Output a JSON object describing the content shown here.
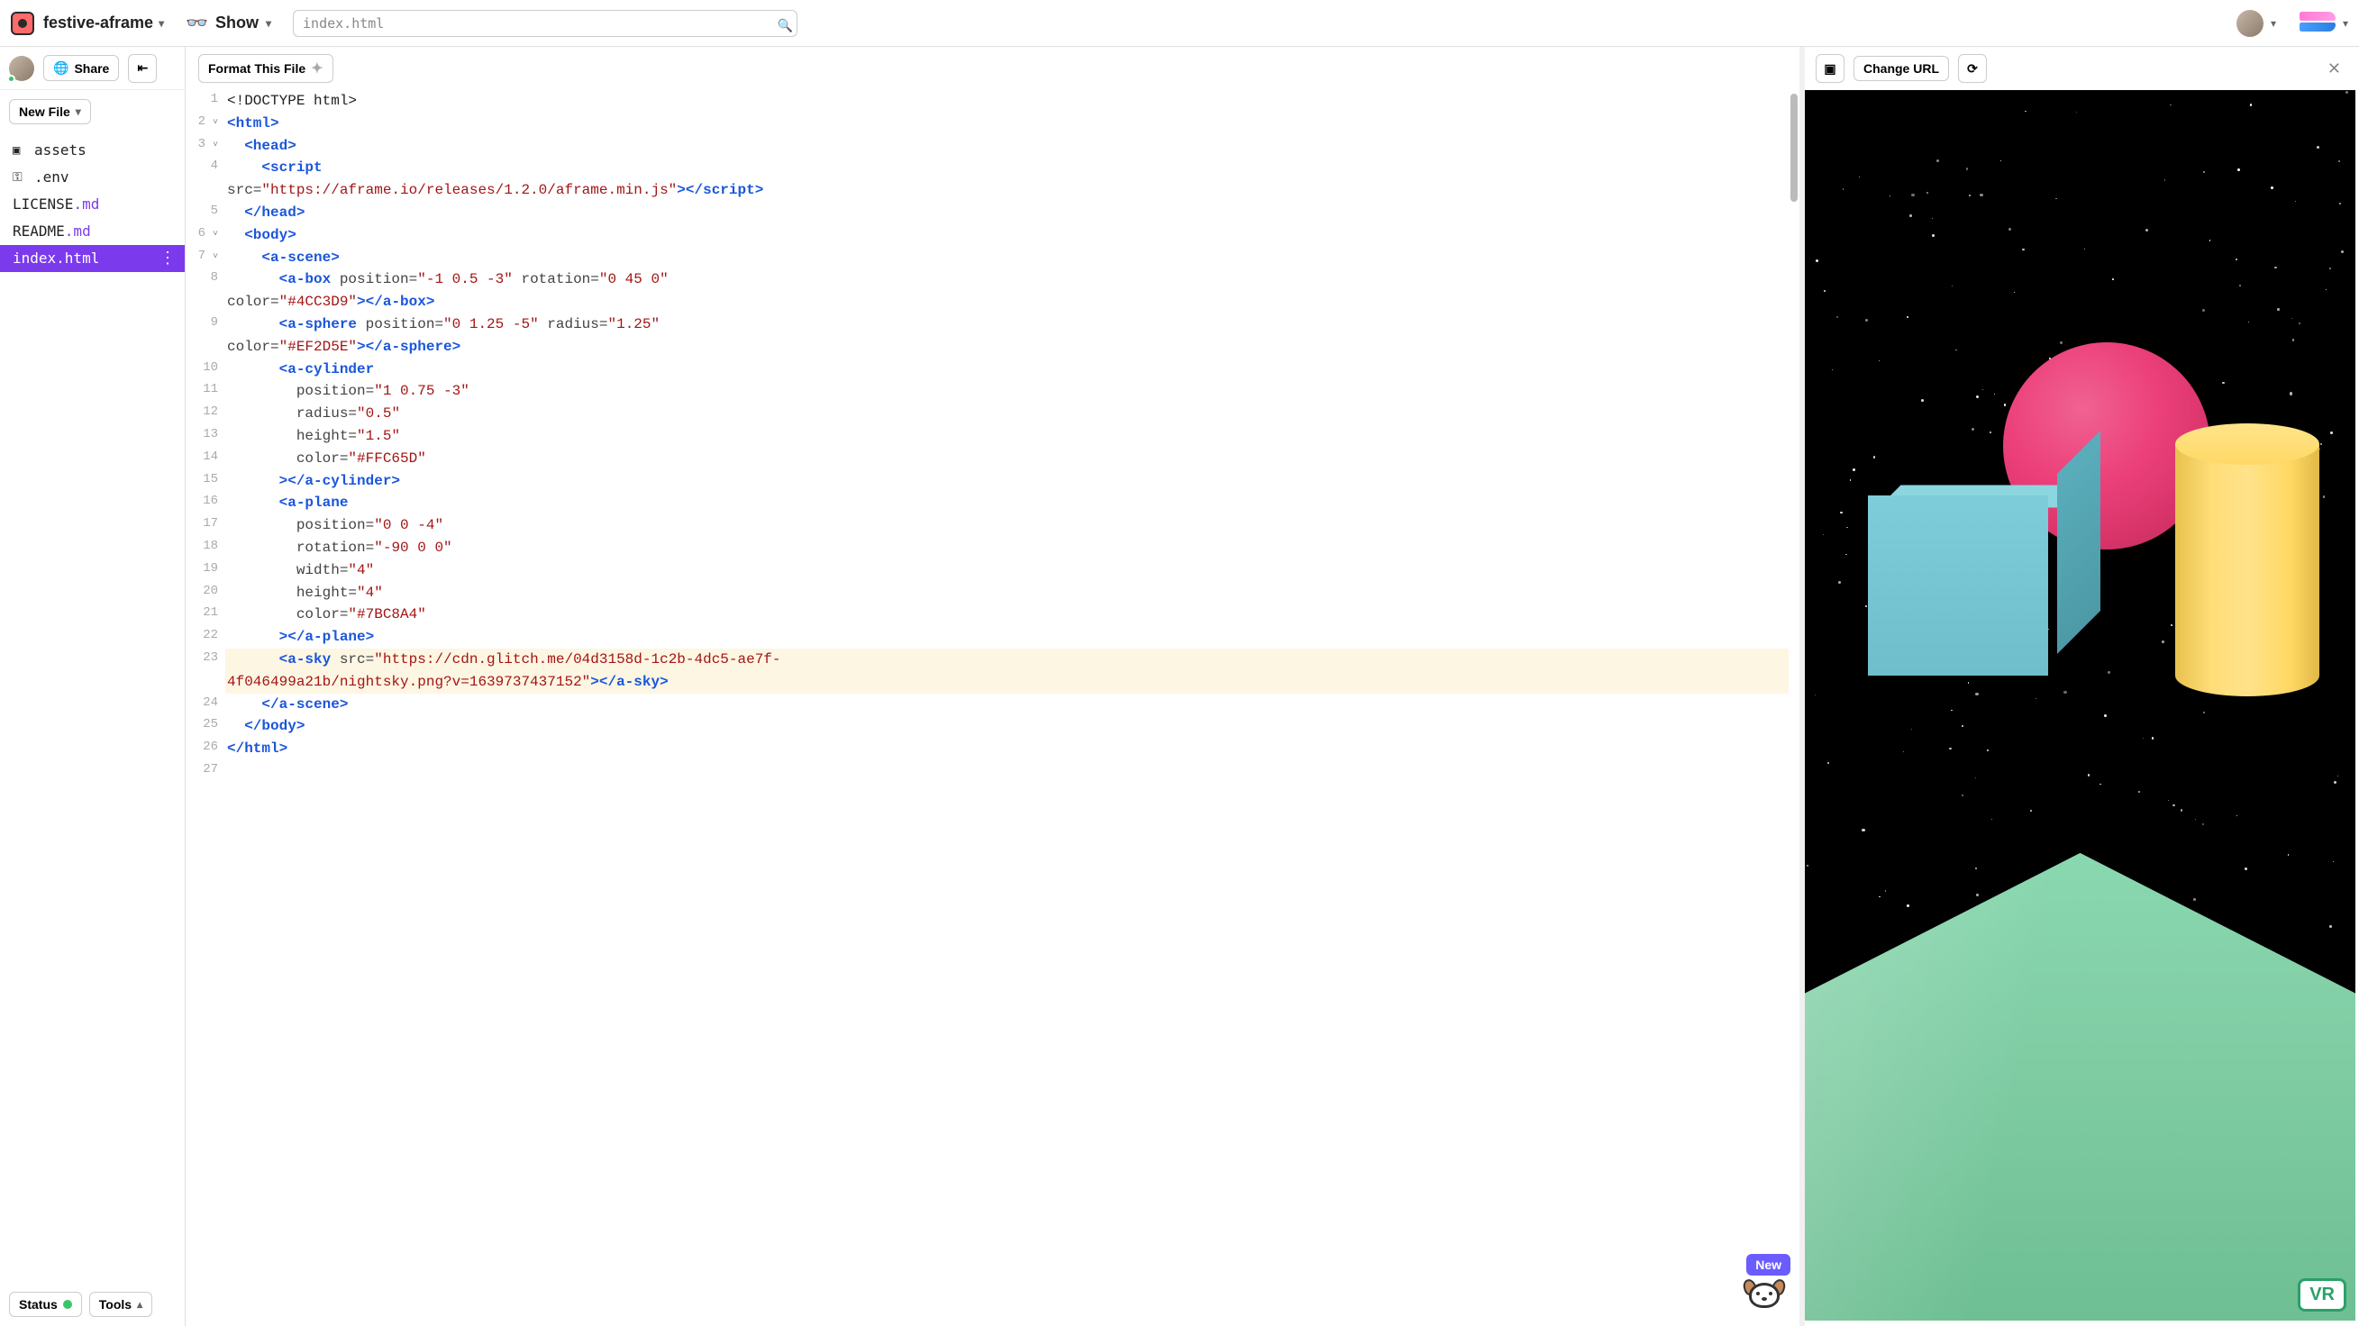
{
  "header": {
    "project_name": "festive-aframe",
    "show_label": "Show",
    "search_value": "index.html"
  },
  "sidebar": {
    "share_label": "Share",
    "new_file_label": "New File",
    "files": [
      {
        "icon": "folder",
        "name": "assets"
      },
      {
        "icon": "key",
        "name": ".env"
      },
      {
        "icon": "",
        "name": "LICENSE",
        "ext": ".md"
      },
      {
        "icon": "",
        "name": "README",
        "ext": ".md"
      },
      {
        "icon": "",
        "name": "index.html",
        "active": true
      }
    ],
    "status_label": "Status",
    "tools_label": "Tools"
  },
  "editor": {
    "format_label": "Format This File",
    "lines": [
      {
        "n": "1",
        "fold": "",
        "segs": [
          [
            "plain",
            "<!DOCTYPE html>"
          ]
        ]
      },
      {
        "n": "2",
        "fold": "v",
        "segs": [
          [
            "tag",
            "<html>"
          ]
        ]
      },
      {
        "n": "3",
        "fold": "v",
        "segs": [
          [
            "plain",
            "  "
          ],
          [
            "tag",
            "<head>"
          ]
        ]
      },
      {
        "n": "4",
        "fold": "",
        "segs": [
          [
            "plain",
            "    "
          ],
          [
            "tag",
            "<script"
          ]
        ]
      },
      {
        "n": "",
        "fold": "",
        "segs": [
          [
            "attr",
            "src="
          ],
          [
            "str",
            "\"https://aframe.io/releases/1.2.0/aframe.min.js\""
          ],
          [
            "tag",
            "></"
          ],
          [
            "tag",
            "script>"
          ]
        ]
      },
      {
        "n": "5",
        "fold": "",
        "segs": [
          [
            "plain",
            "  "
          ],
          [
            "tag",
            "</head>"
          ]
        ]
      },
      {
        "n": "6",
        "fold": "v",
        "segs": [
          [
            "plain",
            "  "
          ],
          [
            "tag",
            "<body>"
          ]
        ]
      },
      {
        "n": "7",
        "fold": "v",
        "segs": [
          [
            "plain",
            "    "
          ],
          [
            "tag",
            "<a-scene>"
          ]
        ]
      },
      {
        "n": "8",
        "fold": "",
        "segs": [
          [
            "plain",
            "      "
          ],
          [
            "tag",
            "<a-box"
          ],
          [
            "attr",
            " position="
          ],
          [
            "str",
            "\"-1 0.5 -3\""
          ],
          [
            "attr",
            " rotation="
          ],
          [
            "str",
            "\"0 45 0\""
          ]
        ]
      },
      {
        "n": "",
        "fold": "",
        "segs": [
          [
            "attr",
            "color="
          ],
          [
            "str",
            "\"#4CC3D9\""
          ],
          [
            "tag",
            "></a-box>"
          ]
        ]
      },
      {
        "n": "9",
        "fold": "",
        "segs": [
          [
            "plain",
            "      "
          ],
          [
            "tag",
            "<a-sphere"
          ],
          [
            "attr",
            " position="
          ],
          [
            "str",
            "\"0 1.25 -5\""
          ],
          [
            "attr",
            " radius="
          ],
          [
            "str",
            "\"1.25\""
          ]
        ]
      },
      {
        "n": "",
        "fold": "",
        "segs": [
          [
            "attr",
            "color="
          ],
          [
            "str",
            "\"#EF2D5E\""
          ],
          [
            "tag",
            "></a-sphere>"
          ]
        ]
      },
      {
        "n": "10",
        "fold": "",
        "segs": [
          [
            "plain",
            "      "
          ],
          [
            "tag",
            "<a-cylinder"
          ]
        ]
      },
      {
        "n": "11",
        "fold": "",
        "segs": [
          [
            "plain",
            "        "
          ],
          [
            "attr",
            "position="
          ],
          [
            "str",
            "\"1 0.75 -3\""
          ]
        ]
      },
      {
        "n": "12",
        "fold": "",
        "segs": [
          [
            "plain",
            "        "
          ],
          [
            "attr",
            "radius="
          ],
          [
            "str",
            "\"0.5\""
          ]
        ]
      },
      {
        "n": "13",
        "fold": "",
        "segs": [
          [
            "plain",
            "        "
          ],
          [
            "attr",
            "height="
          ],
          [
            "str",
            "\"1.5\""
          ]
        ]
      },
      {
        "n": "14",
        "fold": "",
        "segs": [
          [
            "plain",
            "        "
          ],
          [
            "attr",
            "color="
          ],
          [
            "str",
            "\"#FFC65D\""
          ]
        ]
      },
      {
        "n": "15",
        "fold": "",
        "segs": [
          [
            "plain",
            "      "
          ],
          [
            "tag",
            "></a-cylinder>"
          ]
        ]
      },
      {
        "n": "16",
        "fold": "",
        "segs": [
          [
            "plain",
            "      "
          ],
          [
            "tag",
            "<a-plane"
          ]
        ]
      },
      {
        "n": "17",
        "fold": "",
        "segs": [
          [
            "plain",
            "        "
          ],
          [
            "attr",
            "position="
          ],
          [
            "str",
            "\"0 0 -4\""
          ]
        ]
      },
      {
        "n": "18",
        "fold": "",
        "segs": [
          [
            "plain",
            "        "
          ],
          [
            "attr",
            "rotation="
          ],
          [
            "str",
            "\"-90 0 0\""
          ]
        ]
      },
      {
        "n": "19",
        "fold": "",
        "segs": [
          [
            "plain",
            "        "
          ],
          [
            "attr",
            "width="
          ],
          [
            "str",
            "\"4\""
          ]
        ]
      },
      {
        "n": "20",
        "fold": "",
        "segs": [
          [
            "plain",
            "        "
          ],
          [
            "attr",
            "height="
          ],
          [
            "str",
            "\"4\""
          ]
        ]
      },
      {
        "n": "21",
        "fold": "",
        "segs": [
          [
            "plain",
            "        "
          ],
          [
            "attr",
            "color="
          ],
          [
            "str",
            "\"#7BC8A4\""
          ]
        ]
      },
      {
        "n": "22",
        "fold": "",
        "segs": [
          [
            "plain",
            "      "
          ],
          [
            "tag",
            "></a-plane>"
          ]
        ]
      },
      {
        "n": "23",
        "fold": "",
        "hl": true,
        "segs": [
          [
            "plain",
            "      "
          ],
          [
            "tag",
            "<a-sky"
          ],
          [
            "attr",
            " src="
          ],
          [
            "str",
            "\"https://cdn.glitch.me/04d3158d-1c2b-4dc5-ae7f-"
          ]
        ]
      },
      {
        "n": "",
        "fold": "",
        "hl": true,
        "segs": [
          [
            "str",
            "4f046499a21b/nightsky.png?v=1639737437152\""
          ],
          [
            "tag",
            "></a-sky>"
          ]
        ]
      },
      {
        "n": "24",
        "fold": "",
        "segs": [
          [
            "plain",
            "    "
          ],
          [
            "tag",
            "</a-scene>"
          ]
        ]
      },
      {
        "n": "25",
        "fold": "",
        "segs": [
          [
            "plain",
            "  "
          ],
          [
            "tag",
            "</body>"
          ]
        ]
      },
      {
        "n": "26",
        "fold": "",
        "segs": [
          [
            "tag",
            "</html>"
          ]
        ]
      },
      {
        "n": "27",
        "fold": "",
        "segs": [
          [
            "plain",
            ""
          ]
        ]
      }
    ]
  },
  "preview": {
    "change_url_label": "Change URL",
    "vr_label": "VR",
    "new_label": "New",
    "scene_colors": {
      "box": "#4CC3D9",
      "sphere": "#EF2D5E",
      "cylinder": "#FFC65D",
      "plane": "#7BC8A4"
    }
  }
}
